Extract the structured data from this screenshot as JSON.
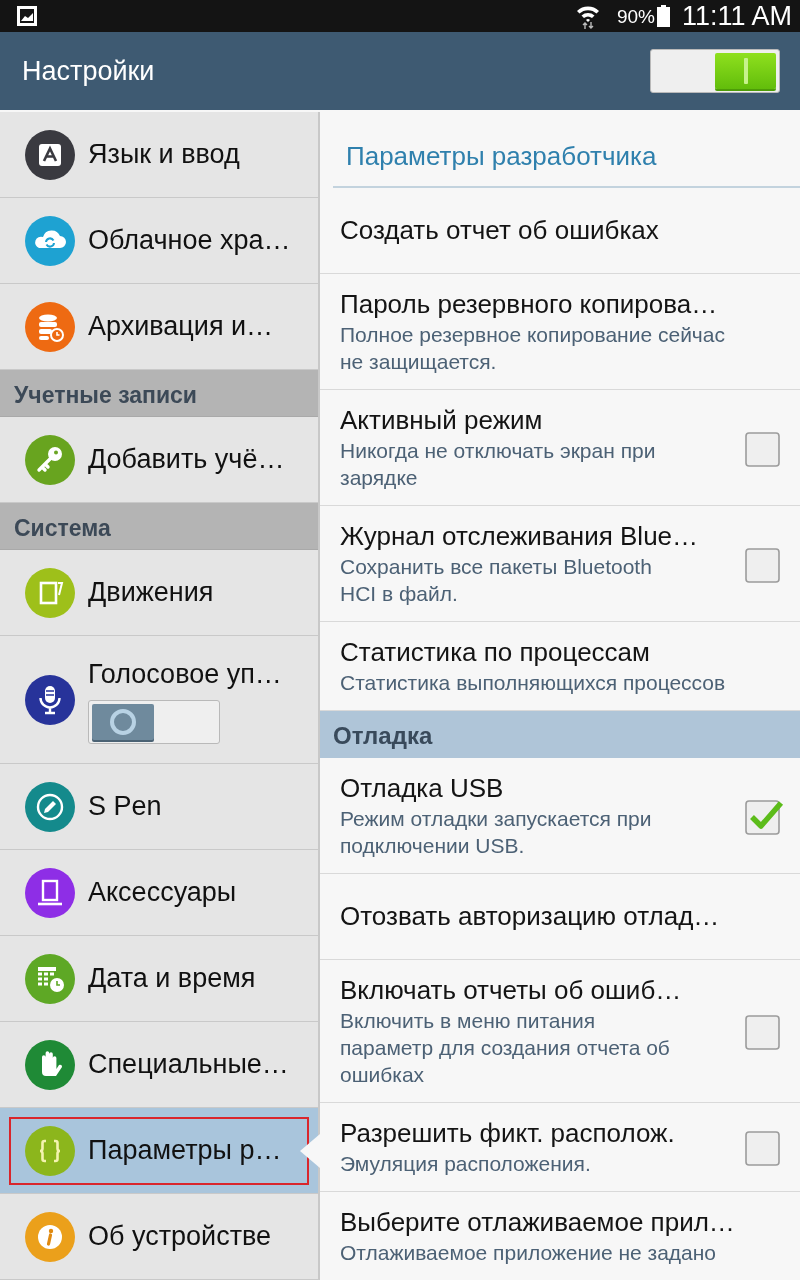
{
  "status_bar": {
    "battery": "90%",
    "time": "11:11 AM"
  },
  "header": {
    "title": "Настройки",
    "toggle": {
      "on": true
    }
  },
  "sidebar": {
    "items": [
      {
        "kind": "item",
        "label": "Язык и ввод",
        "color": "#3a3a40",
        "selected": false
      },
      {
        "kind": "item",
        "label": "Облачное хра…",
        "color": "#1ea2d2",
        "selected": false
      },
      {
        "kind": "item",
        "label": "Архивация и…",
        "color": "#ee6a12",
        "selected": false
      },
      {
        "kind": "section",
        "label": "Учетные записи"
      },
      {
        "kind": "item",
        "label": "Добавить учё…",
        "color": "#68a41f",
        "selected": false
      },
      {
        "kind": "section",
        "label": "Система"
      },
      {
        "kind": "item",
        "label": "Движения",
        "color": "#9ec01a",
        "selected": false
      },
      {
        "kind": "switch",
        "label": "Голосовое уп…",
        "color": "#27339a",
        "selected": false,
        "on": false
      },
      {
        "kind": "item",
        "label": "S Pen",
        "color": "#148a8c",
        "selected": false
      },
      {
        "kind": "item",
        "label": "Аксессуары",
        "color": "#8e2ee6",
        "selected": false
      },
      {
        "kind": "item",
        "label": "Дата и время",
        "color": "#5ea825",
        "selected": false
      },
      {
        "kind": "item",
        "label": "Специальные…",
        "color": "#1f8a36",
        "selected": false
      },
      {
        "kind": "item",
        "label": "Параметры р…",
        "color": "#8cb61c",
        "selected": true
      },
      {
        "kind": "item",
        "label": "Об устройстве",
        "color": "#eba01b",
        "selected": false
      }
    ]
  },
  "content": {
    "title": "Параметры разработчика",
    "items": [
      {
        "kind": "item",
        "title": "Создать отчет об ошибках"
      },
      {
        "kind": "item",
        "title": "Пароль резервного копирова…",
        "description": "Полное резервное копирование сейчас не защищается."
      },
      {
        "kind": "checkbox",
        "title": "Активный режим",
        "description": "Никогда не отключать экран при зарядке",
        "checked": false
      },
      {
        "kind": "checkbox",
        "title": "Журнал отслеживания Blue…",
        "description": "Сохранить все пакеты Bluetooth HCI в файл.",
        "checked": false
      },
      {
        "kind": "item",
        "title": "Статистика по процессам",
        "description": "Статистика выполняющихся процессов"
      },
      {
        "kind": "section",
        "title": "Отладка"
      },
      {
        "kind": "checkbox",
        "title": "Отладка USB",
        "description": "Режим отладки запускается при подключении USB.",
        "checked": true
      },
      {
        "kind": "item",
        "title": "Отозвать авторизацию отлад…"
      },
      {
        "kind": "checkbox",
        "title": "Включать отчеты об ошиб…",
        "description": "Включить в меню питания параметр для создания отчета об ошибках",
        "checked": false
      },
      {
        "kind": "checkbox",
        "title": "Разрешить фикт. располож.",
        "description": "Эмуляция расположения.",
        "checked": false
      },
      {
        "kind": "item",
        "title": "Выберите отлаживаемое прил…",
        "description": "Отлаживаемое приложение не задано"
      }
    ]
  }
}
